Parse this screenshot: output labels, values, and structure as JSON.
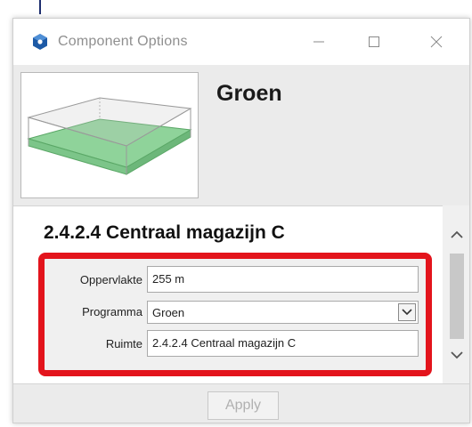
{
  "window": {
    "title": "Component Options",
    "icon": "sketchup-icon",
    "controls": [
      "minimize-icon",
      "maximize-icon",
      "close-icon"
    ]
  },
  "component": {
    "name": "Groen",
    "thumbnail": "green-box-thumbnail"
  },
  "section": {
    "title": "2.4.2.4 Centraal magazijn C"
  },
  "fields": {
    "oppervlakte": {
      "label": "Oppervlakte",
      "value": "255 m"
    },
    "programma": {
      "label": "Programma",
      "value": "Groen"
    },
    "ruimte": {
      "label": "Ruimte",
      "value": "2.4.2.4 Centraal magazijn C"
    }
  },
  "footer": {
    "apply_label": "Apply"
  },
  "colors": {
    "highlight": "#e3141c",
    "thumbnail_fill": "#8fd39a"
  }
}
